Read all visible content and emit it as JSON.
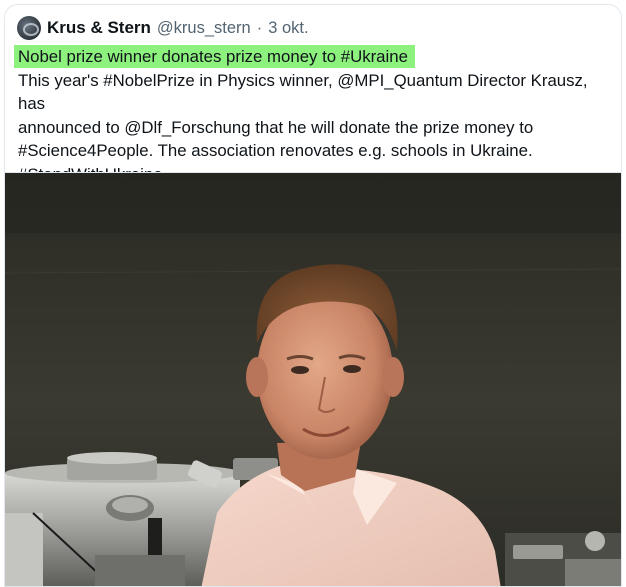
{
  "tweet": {
    "author": {
      "display_name": "Krus & Stern",
      "handle": "@krus_stern",
      "separator": "·",
      "date": "3 okt."
    },
    "headline": "Nobel prize winner donates prize money to #Ukraine",
    "text_lines": [
      "This year's #NobelPrize in Physics winner, @MPI_Quantum Director Krausz, has",
      "announced to @Dlf_Forschung that he will donate the prize money to",
      "#Science4People. The association renovates e.g. schools in Ukraine.",
      "#StandWithUkraine"
    ],
    "headline_highlight_color": "#8df17e"
  }
}
